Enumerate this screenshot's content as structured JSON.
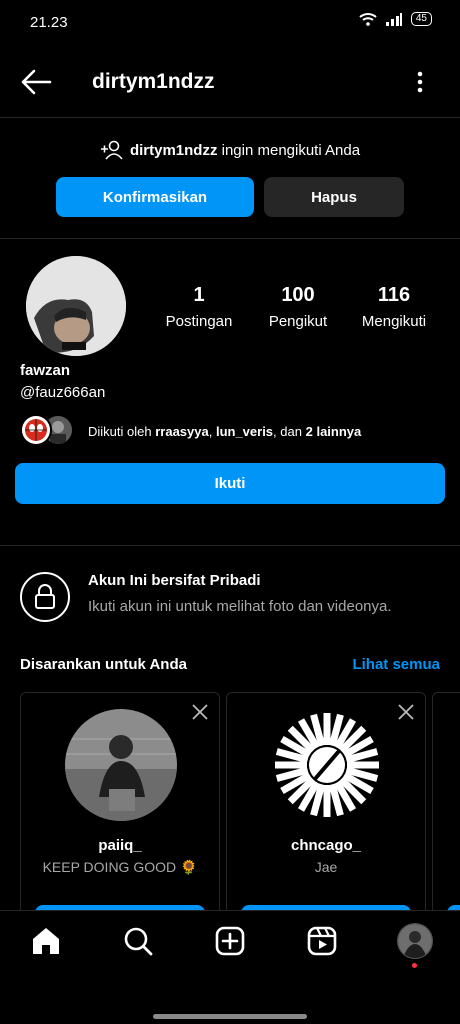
{
  "status": {
    "time": "21.23",
    "battery": "45"
  },
  "header": {
    "username": "dirtym1ndzz"
  },
  "request": {
    "username": "dirtym1ndzz",
    "text": "ingin mengikuti Anda",
    "confirm_label": "Konfirmasikan",
    "delete_label": "Hapus"
  },
  "profile": {
    "name": "fawzan",
    "handle": "@fauz666an",
    "stats": [
      {
        "value": "1",
        "label": "Postingan"
      },
      {
        "value": "100",
        "label": "Pengikut"
      },
      {
        "value": "116",
        "label": "Mengikuti"
      }
    ],
    "followed_by": {
      "prefix": "Diikuti oleh",
      "user1": "rraasyya",
      "user2": "lun_veris",
      "joiner": "dan",
      "others": "2 lainnya"
    },
    "follow_label": "Ikuti"
  },
  "private": {
    "title": "Akun Ini bersifat Pribadi",
    "subtitle": "Ikuti akun ini untuk melihat foto dan videonya."
  },
  "suggestions": {
    "title": "Disarankan untuk Anda",
    "see_all": "Lihat semua",
    "cards": [
      {
        "name": "paiiq_",
        "subtitle": "KEEP DOING GOOD 🌻"
      },
      {
        "name": "chncago_",
        "subtitle": "Jae"
      }
    ]
  },
  "nav": [
    "home-icon",
    "search-icon",
    "create-icon",
    "reels-icon",
    "profile-avatar"
  ],
  "colors": {
    "accent": "#0095f6",
    "secondary_button": "#262626",
    "muted_text": "#a8a8a8",
    "notification_dot": "#ff3040"
  }
}
